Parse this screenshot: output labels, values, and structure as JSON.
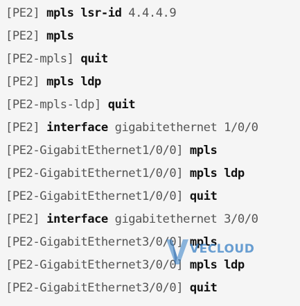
{
  "terminal": {
    "lines": [
      {
        "prompt": "[PE2]",
        "cmd": "mpls lsr-id",
        "arg": "4.4.4.9"
      },
      {
        "prompt": "[PE2]",
        "cmd": "mpls",
        "arg": ""
      },
      {
        "prompt": "[PE2-mpls]",
        "cmd": "quit",
        "arg": ""
      },
      {
        "prompt": "[PE2]",
        "cmd": "mpls ldp",
        "arg": ""
      },
      {
        "prompt": "[PE2-mpls-ldp]",
        "cmd": "quit",
        "arg": ""
      },
      {
        "prompt": "[PE2]",
        "cmd": "interface",
        "arg": "gigabitethernet 1/0/0"
      },
      {
        "prompt": "[PE2-GigabitEthernet1/0/0]",
        "cmd": "mpls",
        "arg": ""
      },
      {
        "prompt": "[PE2-GigabitEthernet1/0/0]",
        "cmd": "mpls ldp",
        "arg": ""
      },
      {
        "prompt": "[PE2-GigabitEthernet1/0/0]",
        "cmd": "quit",
        "arg": ""
      },
      {
        "prompt": "[PE2]",
        "cmd": "interface",
        "arg": "gigabitethernet 3/0/0"
      },
      {
        "prompt": "[PE2-GigabitEthernet3/0/0]",
        "cmd": "mpls",
        "arg": ""
      },
      {
        "prompt": "[PE2-GigabitEthernet3/0/0]",
        "cmd": "mpls ldp",
        "arg": ""
      },
      {
        "prompt": "[PE2-GigabitEthernet3/0/0]",
        "cmd": "quit",
        "arg": ""
      }
    ]
  },
  "watermark": {
    "text": "VECLOUD",
    "icon": "vecloud-logo-icon",
    "color": "#307bc4"
  },
  "colors": {
    "background": "#f5f5f5",
    "command": "#111111",
    "prompt": "#555555"
  }
}
